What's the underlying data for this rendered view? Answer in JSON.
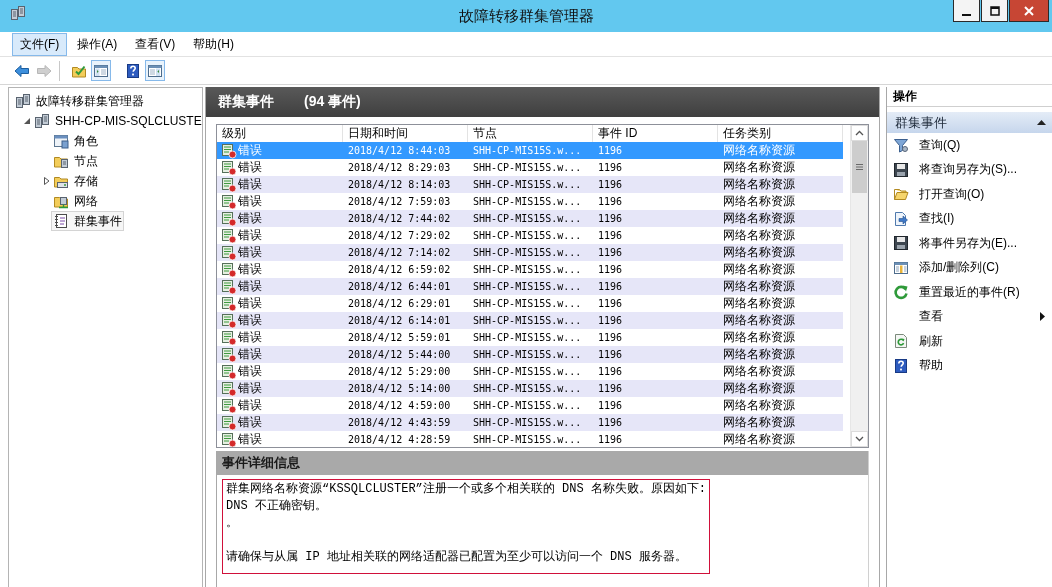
{
  "window": {
    "title": "故障转移群集管理器"
  },
  "menu": [
    {
      "label": "文件(F)",
      "selected": true
    },
    {
      "label": "操作(A)",
      "selected": false
    },
    {
      "label": "查看(V)",
      "selected": false
    },
    {
      "label": "帮助(H)",
      "selected": false
    }
  ],
  "toolbar": [
    [
      {
        "kind": "back",
        "disabled": false,
        "on": false
      },
      {
        "kind": "forward",
        "disabled": true,
        "on": false
      }
    ],
    [
      {
        "kind": "folder",
        "disabled": false,
        "on": false
      },
      {
        "kind": "tree",
        "disabled": false,
        "on": true
      },
      {
        "kind": "help",
        "disabled": false,
        "on": false
      },
      {
        "kind": "actions",
        "disabled": false,
        "on": true
      }
    ]
  ],
  "tree": [
    {
      "kind": "manager",
      "label": "故障转移群集管理器",
      "selected": false,
      "children": [
        {
          "kind": "cluster",
          "label": "SHH-CP-MIS-SQLCLUSTE",
          "selected": false,
          "expanded": true,
          "children": [
            {
              "kind": "roles",
              "label": "角色",
              "selected": false
            },
            {
              "kind": "nodes",
              "label": "节点",
              "selected": false
            },
            {
              "kind": "storage",
              "label": "存储",
              "selected": false,
              "expanded": false
            },
            {
              "kind": "networks",
              "label": "网络",
              "selected": false
            },
            {
              "kind": "events",
              "label": "群集事件",
              "selected": true
            }
          ]
        }
      ]
    }
  ],
  "events": {
    "title": "群集事件",
    "count": "(94 事件)",
    "table": {
      "columns": [
        "级别",
        "日期和时间",
        "节点",
        "事件 ID",
        "任务类别"
      ],
      "rows": [
        {
          "level": "错误",
          "date_time": "2018/4/12 8:44:03",
          "node": "SHH-CP-MIS15S.w...",
          "event_id": "1196",
          "task_category": "网络名称资源",
          "selected": true
        },
        {
          "level": "错误",
          "date_time": "2018/4/12 8:29:03",
          "node": "SHH-CP-MIS15S.w...",
          "event_id": "1196",
          "task_category": "网络名称资源",
          "selected": false
        },
        {
          "level": "错误",
          "date_time": "2018/4/12 8:14:03",
          "node": "SHH-CP-MIS15S.w...",
          "event_id": "1196",
          "task_category": "网络名称资源",
          "selected": false
        },
        {
          "level": "错误",
          "date_time": "2018/4/12 7:59:03",
          "node": "SHH-CP-MIS15S.w...",
          "event_id": "1196",
          "task_category": "网络名称资源",
          "selected": false
        },
        {
          "level": "错误",
          "date_time": "2018/4/12 7:44:02",
          "node": "SHH-CP-MIS15S.w...",
          "event_id": "1196",
          "task_category": "网络名称资源",
          "selected": false
        },
        {
          "level": "错误",
          "date_time": "2018/4/12 7:29:02",
          "node": "SHH-CP-MIS15S.w...",
          "event_id": "1196",
          "task_category": "网络名称资源",
          "selected": false
        },
        {
          "level": "错误",
          "date_time": "2018/4/12 7:14:02",
          "node": "SHH-CP-MIS15S.w...",
          "event_id": "1196",
          "task_category": "网络名称资源",
          "selected": false
        },
        {
          "level": "错误",
          "date_time": "2018/4/12 6:59:02",
          "node": "SHH-CP-MIS15S.w...",
          "event_id": "1196",
          "task_category": "网络名称资源",
          "selected": false
        },
        {
          "level": "错误",
          "date_time": "2018/4/12 6:44:01",
          "node": "SHH-CP-MIS15S.w...",
          "event_id": "1196",
          "task_category": "网络名称资源",
          "selected": false
        },
        {
          "level": "错误",
          "date_time": "2018/4/12 6:29:01",
          "node": "SHH-CP-MIS15S.w...",
          "event_id": "1196",
          "task_category": "网络名称资源",
          "selected": false
        },
        {
          "level": "错误",
          "date_time": "2018/4/12 6:14:01",
          "node": "SHH-CP-MIS15S.w...",
          "event_id": "1196",
          "task_category": "网络名称资源",
          "selected": false
        },
        {
          "level": "错误",
          "date_time": "2018/4/12 5:59:01",
          "node": "SHH-CP-MIS15S.w...",
          "event_id": "1196",
          "task_category": "网络名称资源",
          "selected": false
        },
        {
          "level": "错误",
          "date_time": "2018/4/12 5:44:00",
          "node": "SHH-CP-MIS15S.w...",
          "event_id": "1196",
          "task_category": "网络名称资源",
          "selected": false
        },
        {
          "level": "错误",
          "date_time": "2018/4/12 5:29:00",
          "node": "SHH-CP-MIS15S.w...",
          "event_id": "1196",
          "task_category": "网络名称资源",
          "selected": false
        },
        {
          "level": "错误",
          "date_time": "2018/4/12 5:14:00",
          "node": "SHH-CP-MIS15S.w...",
          "event_id": "1196",
          "task_category": "网络名称资源",
          "selected": false
        },
        {
          "level": "错误",
          "date_time": "2018/4/12 4:59:00",
          "node": "SHH-CP-MIS15S.w...",
          "event_id": "1196",
          "task_category": "网络名称资源",
          "selected": false
        },
        {
          "level": "错误",
          "date_time": "2018/4/12 4:43:59",
          "node": "SHH-CP-MIS15S.w...",
          "event_id": "1196",
          "task_category": "网络名称资源",
          "selected": false
        },
        {
          "level": "错误",
          "date_time": "2018/4/12 4:28:59",
          "node": "SHH-CP-MIS15S.w...",
          "event_id": "1196",
          "task_category": "网络名称资源",
          "selected": false
        }
      ]
    }
  },
  "details": {
    "title": "事件详细信息",
    "paragraphs": [
      [
        "群集网络名称资源“KSSQLCLUSTER”注册一个或多个相关联的 DNS 名称失败。原因如下:",
        "DNS 不正确密钥。",
        "。"
      ],
      [
        "请确保与从属 IP 地址相关联的网络适配器已配置为至少可以访问一个 DNS 服务器。"
      ]
    ],
    "highlighted": true
  },
  "actions": {
    "title": "操作",
    "section": {
      "title": "群集事件",
      "expanded": true,
      "items": [
        {
          "kind": "query",
          "label": "查询(Q)"
        },
        {
          "kind": "save",
          "label": "将查询另存为(S)..."
        },
        {
          "kind": "open",
          "label": "打开查询(O)"
        },
        {
          "kind": "find",
          "label": "查找(I)"
        },
        {
          "kind": "save",
          "label": "将事件另存为(E)..."
        },
        {
          "kind": "columns",
          "label": "添加/删除列(C)"
        },
        {
          "kind": "reset",
          "label": "重置最近的事件(R)"
        },
        {
          "kind": "submenu",
          "label": "查看"
        },
        {
          "kind": "refresh",
          "label": "刷新"
        },
        {
          "kind": "help",
          "label": "帮助"
        }
      ]
    }
  }
}
